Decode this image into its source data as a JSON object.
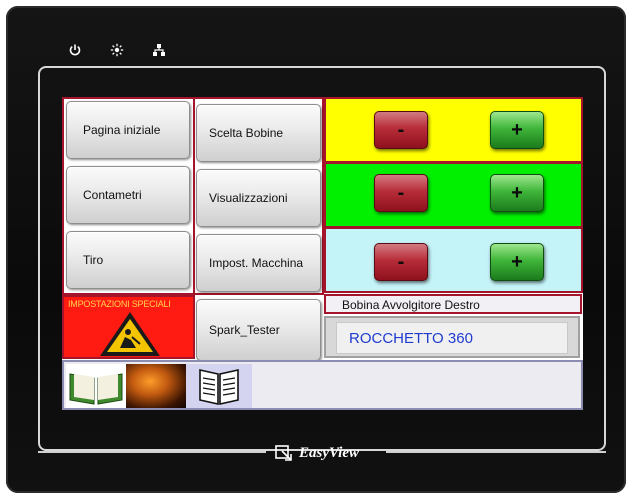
{
  "menu": {
    "pagina_iniziale": "Pagina iniziale",
    "scelta_bobine": "Scelta Bobine",
    "contametri": "Contametri",
    "visualizzazioni": "Visualizzazioni",
    "tiro": "Tiro",
    "impost_macchina": "Impost. Macchina",
    "spark_tester": "Spark_Tester"
  },
  "controls": {
    "minus_label": "-",
    "plus_label": "+",
    "rows": [
      {
        "bg": "#ffff00"
      },
      {
        "bg": "#00f000"
      },
      {
        "bg": "#c4f3f8"
      }
    ]
  },
  "special": {
    "label": "IMPOSTAZIONI SPECIALI",
    "bg": "#ff1b12",
    "icon": "warning-triangle-icon"
  },
  "status": {
    "bobina_label": "Bobina Avvolgitore Destro",
    "rocchetto_value": "ROCCHETTO 360"
  },
  "brand": {
    "name": "EasyView",
    "icons": [
      "power-icon",
      "brightness-icon",
      "network-icon"
    ]
  },
  "bottom_icons": [
    "open-book-icon",
    "fire-image-icon",
    "manual-book-icon"
  ]
}
